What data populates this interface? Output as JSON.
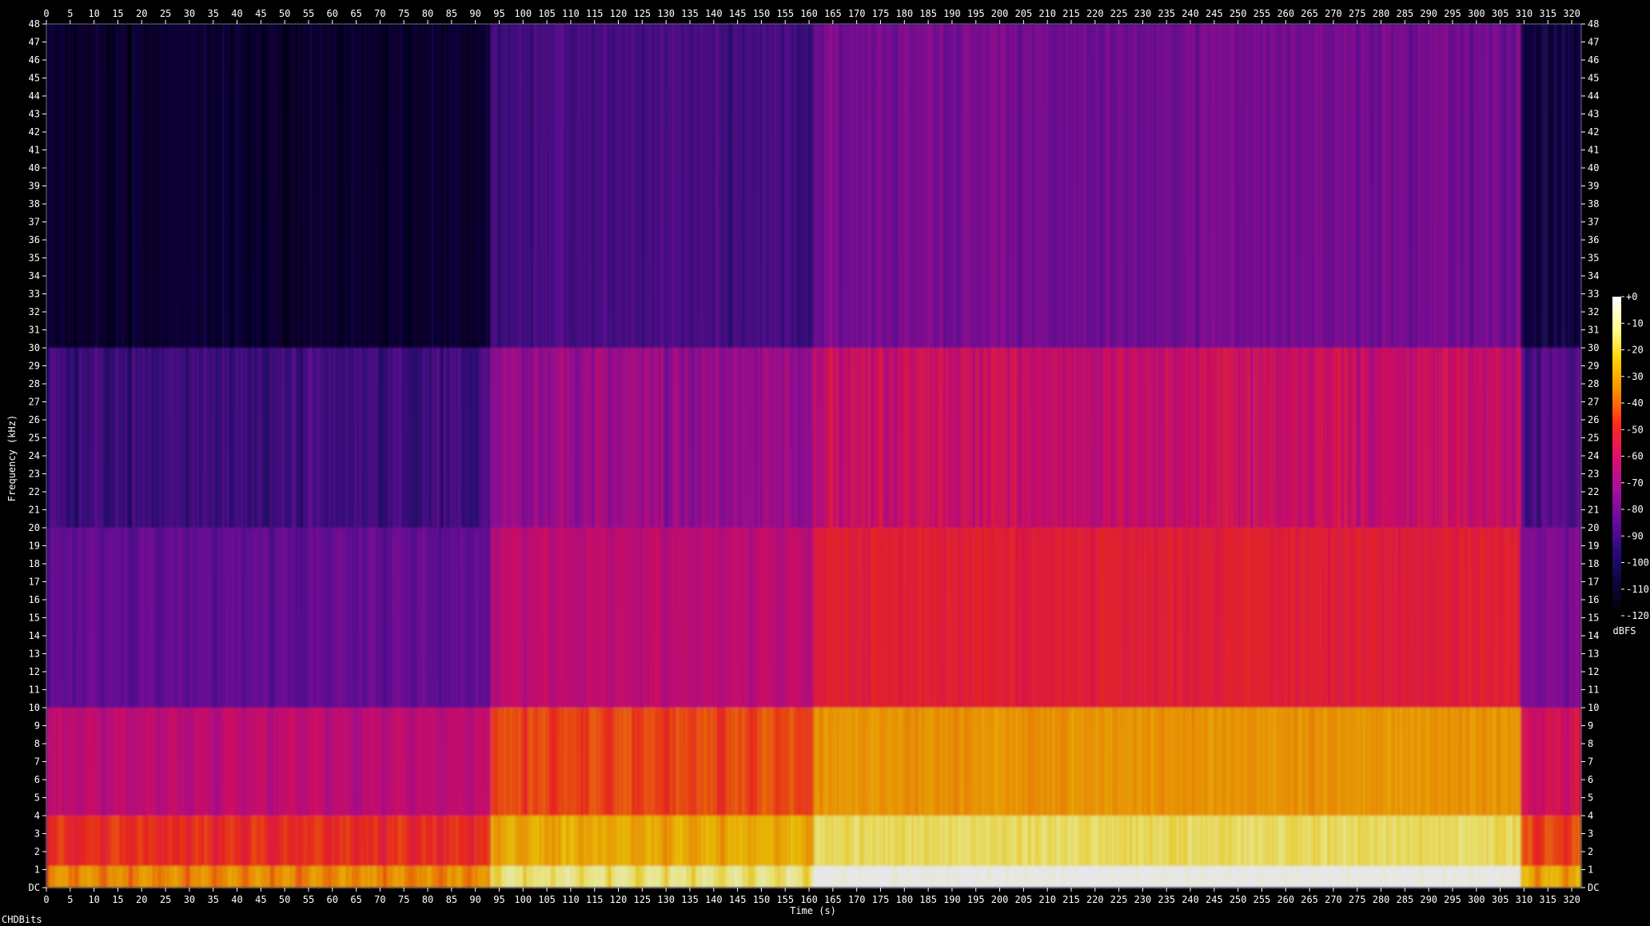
{
  "chart_data": {
    "type": "heatmap",
    "title": "",
    "xlabel": "Time (s)",
    "ylabel": "Frequency (kHz)",
    "xlim": [
      0,
      322
    ],
    "ylim": [
      0,
      48
    ],
    "x_ticks": [
      0,
      5,
      10,
      15,
      20,
      25,
      30,
      35,
      40,
      45,
      50,
      55,
      60,
      65,
      70,
      75,
      80,
      85,
      90,
      95,
      100,
      105,
      110,
      115,
      120,
      125,
      130,
      135,
      140,
      145,
      150,
      155,
      160,
      165,
      170,
      175,
      180,
      185,
      190,
      195,
      200,
      205,
      210,
      215,
      220,
      225,
      230,
      235,
      240,
      245,
      250,
      255,
      260,
      265,
      270,
      275,
      280,
      285,
      290,
      295,
      300,
      305,
      310,
      315,
      320
    ],
    "y_tick_labels": [
      "DC",
      "1",
      "2",
      "3",
      "4",
      "5",
      "6",
      "7",
      "8",
      "9",
      "10",
      "11",
      "12",
      "13",
      "14",
      "15",
      "16",
      "17",
      "18",
      "19",
      "20",
      "21",
      "22",
      "23",
      "24",
      "25",
      "26",
      "27",
      "28",
      "29",
      "30",
      "31",
      "32",
      "33",
      "34",
      "35",
      "36",
      "37",
      "38",
      "39",
      "40",
      "41",
      "42",
      "43",
      "44",
      "45",
      "46",
      "47",
      "48"
    ],
    "colorbar": {
      "label": "dBFS",
      "ticks": [
        "+0",
        "-10",
        "-20",
        "-30",
        "-40",
        "-50",
        "-60",
        "-70",
        "-80",
        "-90",
        "-100",
        "-110",
        "-120"
      ],
      "range": [
        -120,
        0
      ],
      "colors": [
        "#000000",
        "#0b0638",
        "#2a0a78",
        "#6a0aa0",
        "#a8109a",
        "#e0106a",
        "#ff2a1a",
        "#ff8a00",
        "#ffd000",
        "#ffff90",
        "#ffffff"
      ]
    },
    "segments": [
      {
        "start": 0,
        "end": 93,
        "energy": "low",
        "description_level": -60
      },
      {
        "start": 93,
        "end": 161,
        "energy": "medium",
        "description_level": -40
      },
      {
        "start": 161,
        "end": 309,
        "energy": "high",
        "description_level": -30
      },
      {
        "start": 309,
        "end": 322,
        "energy": "low",
        "description_level": -55
      }
    ],
    "grid": false,
    "legend": "right"
  },
  "footer": {
    "text": "CHDBits"
  }
}
